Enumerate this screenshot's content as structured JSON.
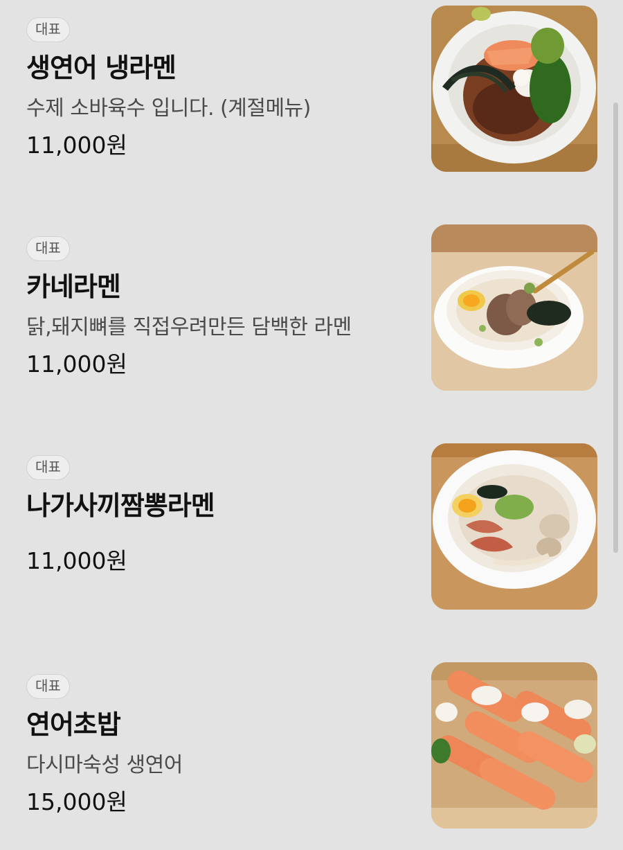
{
  "menu": {
    "items": [
      {
        "badge": "대표",
        "name": "생연어 냉라멘",
        "description": "수제 소바육수 입니다. (계절메뉴)",
        "price": "11,000원",
        "image": "cold-salmon-ramen-photo"
      },
      {
        "badge": "대표",
        "name": "카네라멘",
        "description": "닭,돼지뼈를 직접우려만든 담백한 라멘",
        "price": "11,000원",
        "image": "kane-ramen-photo"
      },
      {
        "badge": "대표",
        "name": "나가사끼짬뽕라멘",
        "description": "",
        "price": "11,000원",
        "image": "nagasaki-jjamppong-ramen-photo"
      },
      {
        "badge": "대표",
        "name": "연어초밥",
        "description": "다시마숙성 생연어",
        "price": "15,000원",
        "image": "salmon-sushi-photo"
      }
    ]
  },
  "colors": {
    "background": "#e3e3e3",
    "text_primary": "#111111",
    "text_secondary": "#4a4a4a",
    "badge_border": "#d2d2d2"
  }
}
